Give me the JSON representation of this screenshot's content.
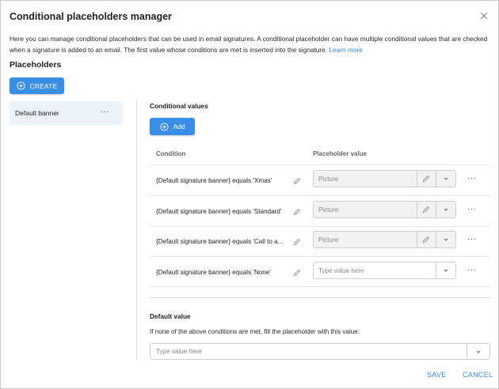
{
  "dialog": {
    "title": "Conditional placeholders manager",
    "intro_text": "Here you can manage conditional placeholders that can be used in email signatures. A conditional placeholder can have multiple conditional values that are checked when a signature is added to an email. The first value whose conditions are met is inserted into the signature.",
    "learn_more": "Learn more"
  },
  "placeholders": {
    "heading": "Placeholders",
    "create_label": "CREATE",
    "items": [
      {
        "label": "Default banner",
        "more": "···"
      }
    ]
  },
  "conditional_values": {
    "heading": "Conditional values",
    "add_label": "Add",
    "columns": {
      "condition": "Condition",
      "placeholder_value": "Placeholder value"
    },
    "rows": [
      {
        "condition": "{Default signature banner} equals 'Xmas'",
        "value": "Picture",
        "more": "···"
      },
      {
        "condition": "{Default signature banner} equals 'Standard'",
        "value": "Picture",
        "more": "···"
      },
      {
        "condition": "{Default signature banner} equals 'Call to a...",
        "value": "Picture",
        "more": "···"
      },
      {
        "condition": "{Default signature banner} equals 'None'",
        "value": "Type value here",
        "more": "···"
      }
    ]
  },
  "default_value": {
    "heading": "Default value",
    "hint": "If none of the above conditions are met, fill the placeholder with this value:",
    "placeholder": "Type value here"
  },
  "footer": {
    "save_label": "SAVE",
    "cancel_label": "CANCEL"
  },
  "colors": {
    "accent": "#3b8ee6",
    "link": "#2c87e0",
    "selected_bg": "#edf3fb"
  },
  "icons": [
    "close-icon",
    "plus-circle-icon",
    "pencil-icon",
    "chevron-down-icon",
    "more-icon"
  ]
}
